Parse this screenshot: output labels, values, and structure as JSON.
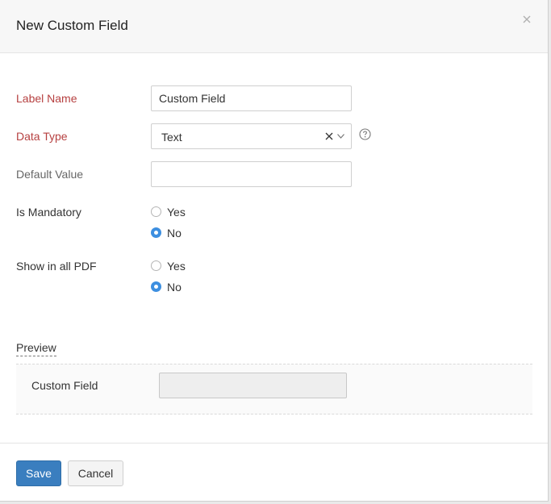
{
  "dialog": {
    "title": "New Custom Field"
  },
  "icons": {
    "close": "close-icon",
    "clear": "clear-icon",
    "dropdown": "chevron-down-icon",
    "help": "help-circle-icon"
  },
  "colors": {
    "required_label": "#b64040",
    "primary_button": "#3a7ebf",
    "radio_selected": "#3d8fe0"
  },
  "form": {
    "label_name": {
      "label": "Label Name",
      "value": "Custom Field"
    },
    "data_type": {
      "label": "Data Type",
      "value": "Text"
    },
    "default_value": {
      "label": "Default Value",
      "value": ""
    },
    "is_mandatory": {
      "label": "Is Mandatory",
      "options": [
        "Yes",
        "No"
      ],
      "selected": "No"
    },
    "show_in_pdf": {
      "label": "Show in all PDF",
      "options": [
        "Yes",
        "No"
      ],
      "selected": "No"
    }
  },
  "preview": {
    "heading": "Preview",
    "field_label": "Custom Field"
  },
  "footer": {
    "save_label": "Save",
    "cancel_label": "Cancel"
  }
}
